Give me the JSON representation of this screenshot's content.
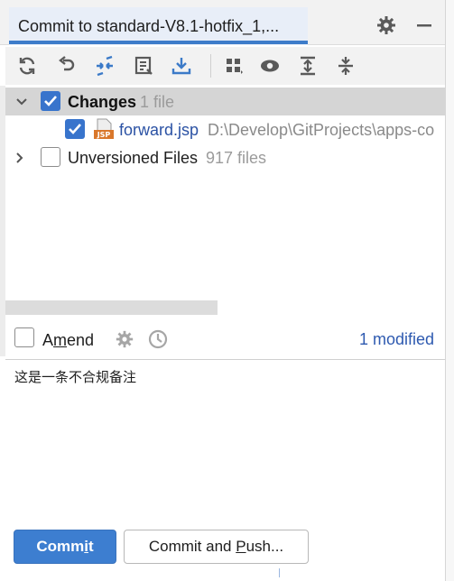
{
  "tab": {
    "title": "Commit to standard-V8.1-hotfix_1,..."
  },
  "title_icons": [
    "gear-icon",
    "minimize-icon"
  ],
  "toolbar": {
    "icons": [
      "refresh-icon",
      "rollback-icon",
      "show-diff-icon",
      "commit-message-history-icon",
      "update-icon",
      "group-by-icon",
      "view-options-icon",
      "expand-all-icon",
      "collapse-all-icon"
    ]
  },
  "tree": {
    "changes": {
      "label": "Changes",
      "count": "1 file",
      "checked": true,
      "expanded": true
    },
    "file": {
      "name": "forward.jsp",
      "path": "D:\\Develop\\GitProjects\\apps-co",
      "icon": "jsp-file-icon",
      "icon_text": "JSP",
      "checked": true
    },
    "unversioned": {
      "label": "Unversioned Files",
      "count": "917 files",
      "checked": false,
      "expanded": false
    }
  },
  "amend": {
    "prefix": "A",
    "underlined": "m",
    "suffix": "end",
    "checked": false,
    "status": "1 modified"
  },
  "message": {
    "text": "这是一条不合规备注"
  },
  "buttons": {
    "commit": {
      "prefix": "Commit",
      "underlined": "",
      "label_parts": [
        "Comm",
        "i",
        "t"
      ]
    },
    "commit_push": {
      "label_parts": [
        "Commit and ",
        "P",
        "ush..."
      ]
    }
  },
  "colors": {
    "accent": "#3d7cc9",
    "checkbox": "#3874cc",
    "primary_button": "#3d7ed0",
    "link": "#2b52a4"
  }
}
